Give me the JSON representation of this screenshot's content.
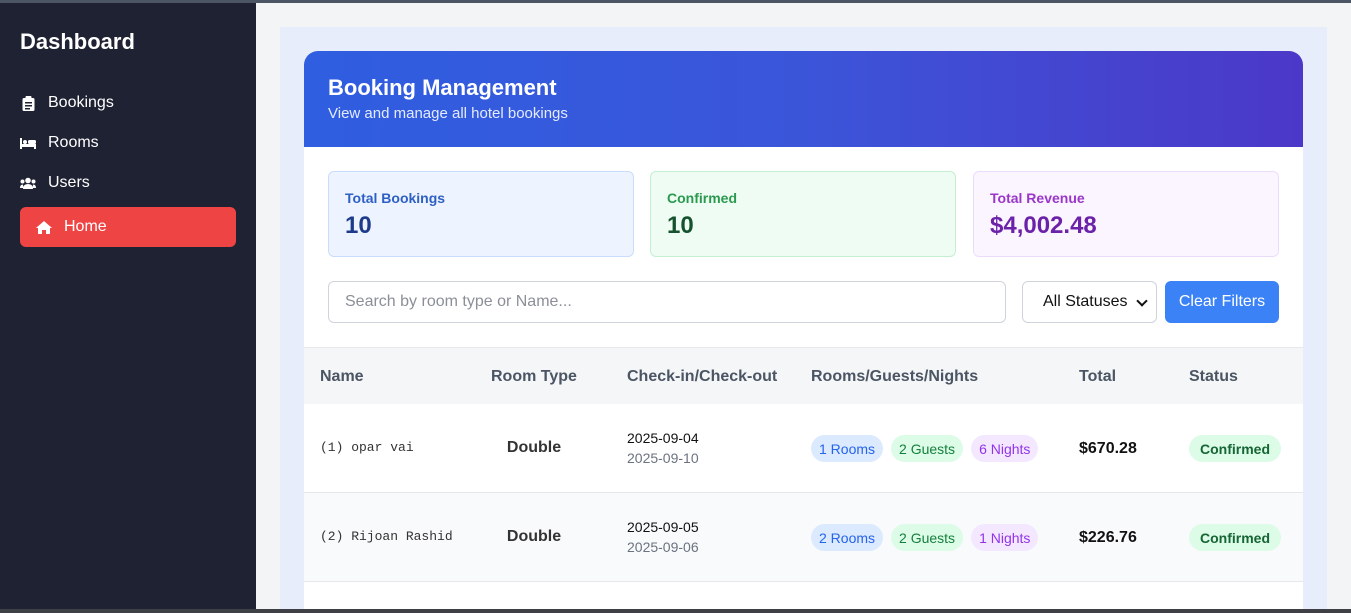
{
  "sidebar": {
    "brand": "Dashboard",
    "items": [
      {
        "label": "Bookings",
        "icon": "clipboard-icon"
      },
      {
        "label": "Rooms",
        "icon": "bed-icon"
      },
      {
        "label": "Users",
        "icon": "users-icon"
      },
      {
        "label": "Home",
        "icon": "home-icon",
        "active": true
      }
    ]
  },
  "header": {
    "title": "Booking Management",
    "subtitle": "View and manage all hotel bookings"
  },
  "stats": [
    {
      "label": "Total Bookings",
      "value": "10"
    },
    {
      "label": "Confirmed",
      "value": "10"
    },
    {
      "label": "Total Revenue",
      "value": "$4,002.48"
    }
  ],
  "filters": {
    "search_placeholder": "Search by room type or Name...",
    "status_selected": "All Statuses",
    "clear_label": "Clear Filters"
  },
  "table": {
    "columns": [
      "Name",
      "Room Type",
      "Check-in/Check-out",
      "Rooms/Guests/Nights",
      "Total",
      "Status"
    ],
    "rows": [
      {
        "name": "(1) opar vai",
        "room_type": "Double",
        "check_in": "2025-09-04",
        "check_out": "2025-09-10",
        "rooms": "1 Rooms",
        "guests": "2 Guests",
        "nights": "6 Nights",
        "total": "$670.28",
        "status": "Confirmed"
      },
      {
        "name": "(2) Rijoan Rashid",
        "room_type": "Double",
        "check_in": "2025-09-05",
        "check_out": "2025-09-06",
        "rooms": "2 Rooms",
        "guests": "2 Guests",
        "nights": "1 Nights",
        "total": "$226.76",
        "status": "Confirmed"
      }
    ]
  },
  "colors": {
    "sidebar_bg": "#1f2232",
    "active_nav": "#ef4444",
    "primary": "#3b82f6",
    "header_gradient_start": "#2f5ee0",
    "header_gradient_end": "#4c38c8"
  }
}
